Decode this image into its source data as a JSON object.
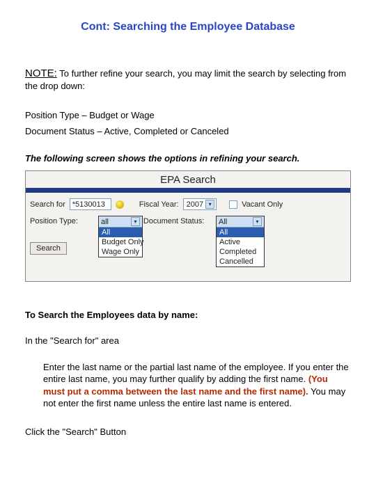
{
  "title": "Cont: Searching the Employee Database",
  "note": {
    "label": "NOTE:",
    "text": "To further refine your search, you may limit the search by selecting from the drop down:"
  },
  "defs": {
    "position_type": "Position Type – Budget or Wage",
    "document_status": "Document Status – Active, Completed or Canceled"
  },
  "leadin": "The following screen shows the options in refining your search.",
  "screenshot": {
    "title": "EPA Search",
    "search_for_label": "Search for",
    "search_for_value": "*5130013",
    "bulb_icon": "lightbulb-icon",
    "fiscal_year_label": "Fiscal Year:",
    "fiscal_year_value": "2007",
    "vacant_label": "Vacant Only",
    "position_type_label": "Position Type:",
    "position_type_sel": "all",
    "position_type_options": [
      "All",
      "Budget Only",
      "Wage Only"
    ],
    "doc_status_label": "Document Status:",
    "doc_status_sel": "All",
    "doc_status_options": [
      "All",
      "Active",
      "Completed",
      "Cancelled"
    ],
    "search_btn": "Search"
  },
  "by_name_head": "To Search the Employees data by name:",
  "by_name_p1": "In the \"Search for\" area",
  "by_name_p2a": "Enter the last name or the partial last name of the employee.  If you enter the entire last name, you may further qualify by adding the first name. ",
  "by_name_hl": "(You must put a comma between the last name and the first name).",
  "by_name_p2b": "  You may not enter the first name unless the entire last name is entered.",
  "by_name_p3": "Click the \"Search\" Button"
}
